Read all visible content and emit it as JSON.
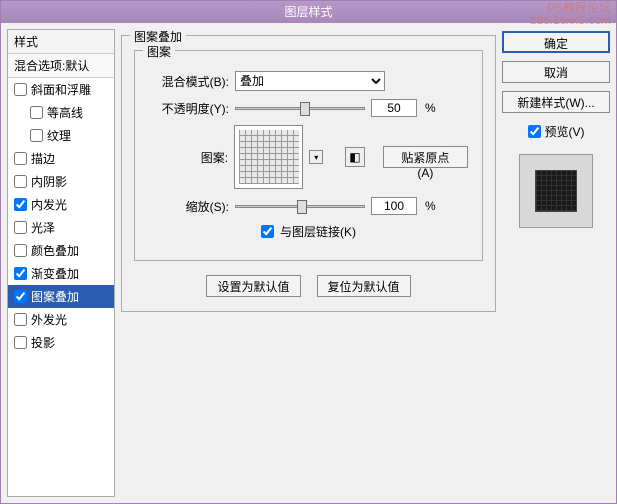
{
  "title": "图层样式",
  "watermark": {
    "l1": "PS教程论坛",
    "l2": "bbs.16xx8.com"
  },
  "styles": {
    "header": "样式",
    "sub": "混合选项:默认",
    "items": [
      {
        "label": "斜面和浮雕",
        "checked": false,
        "indent": false
      },
      {
        "label": "等高线",
        "checked": false,
        "indent": true
      },
      {
        "label": "纹理",
        "checked": false,
        "indent": true
      },
      {
        "label": "描边",
        "checked": false,
        "indent": false
      },
      {
        "label": "内阴影",
        "checked": false,
        "indent": false
      },
      {
        "label": "内发光",
        "checked": true,
        "indent": false
      },
      {
        "label": "光泽",
        "checked": false,
        "indent": false
      },
      {
        "label": "颜色叠加",
        "checked": false,
        "indent": false
      },
      {
        "label": "渐变叠加",
        "checked": true,
        "indent": false
      },
      {
        "label": "图案叠加",
        "checked": true,
        "indent": false,
        "selected": true
      },
      {
        "label": "外发光",
        "checked": false,
        "indent": false
      },
      {
        "label": "投影",
        "checked": false,
        "indent": false
      }
    ]
  },
  "main": {
    "group_label": "图案叠加",
    "sub_label": "图案",
    "blend_label": "混合模式(B):",
    "blend_value": "叠加",
    "opacity_label": "不透明度(Y):",
    "opacity_value": "50",
    "pattern_label": "图案:",
    "snap_origin": "贴紧原点(A)",
    "scale_label": "缩放(S):",
    "scale_value": "100",
    "link_label": "与图层链接(K)",
    "link_checked": true,
    "set_default": "设置为默认值",
    "reset_default": "复位为默认值",
    "percent": "%"
  },
  "right": {
    "ok": "确定",
    "cancel": "取消",
    "new_style": "新建样式(W)...",
    "preview": "预览(V)",
    "preview_checked": true
  }
}
